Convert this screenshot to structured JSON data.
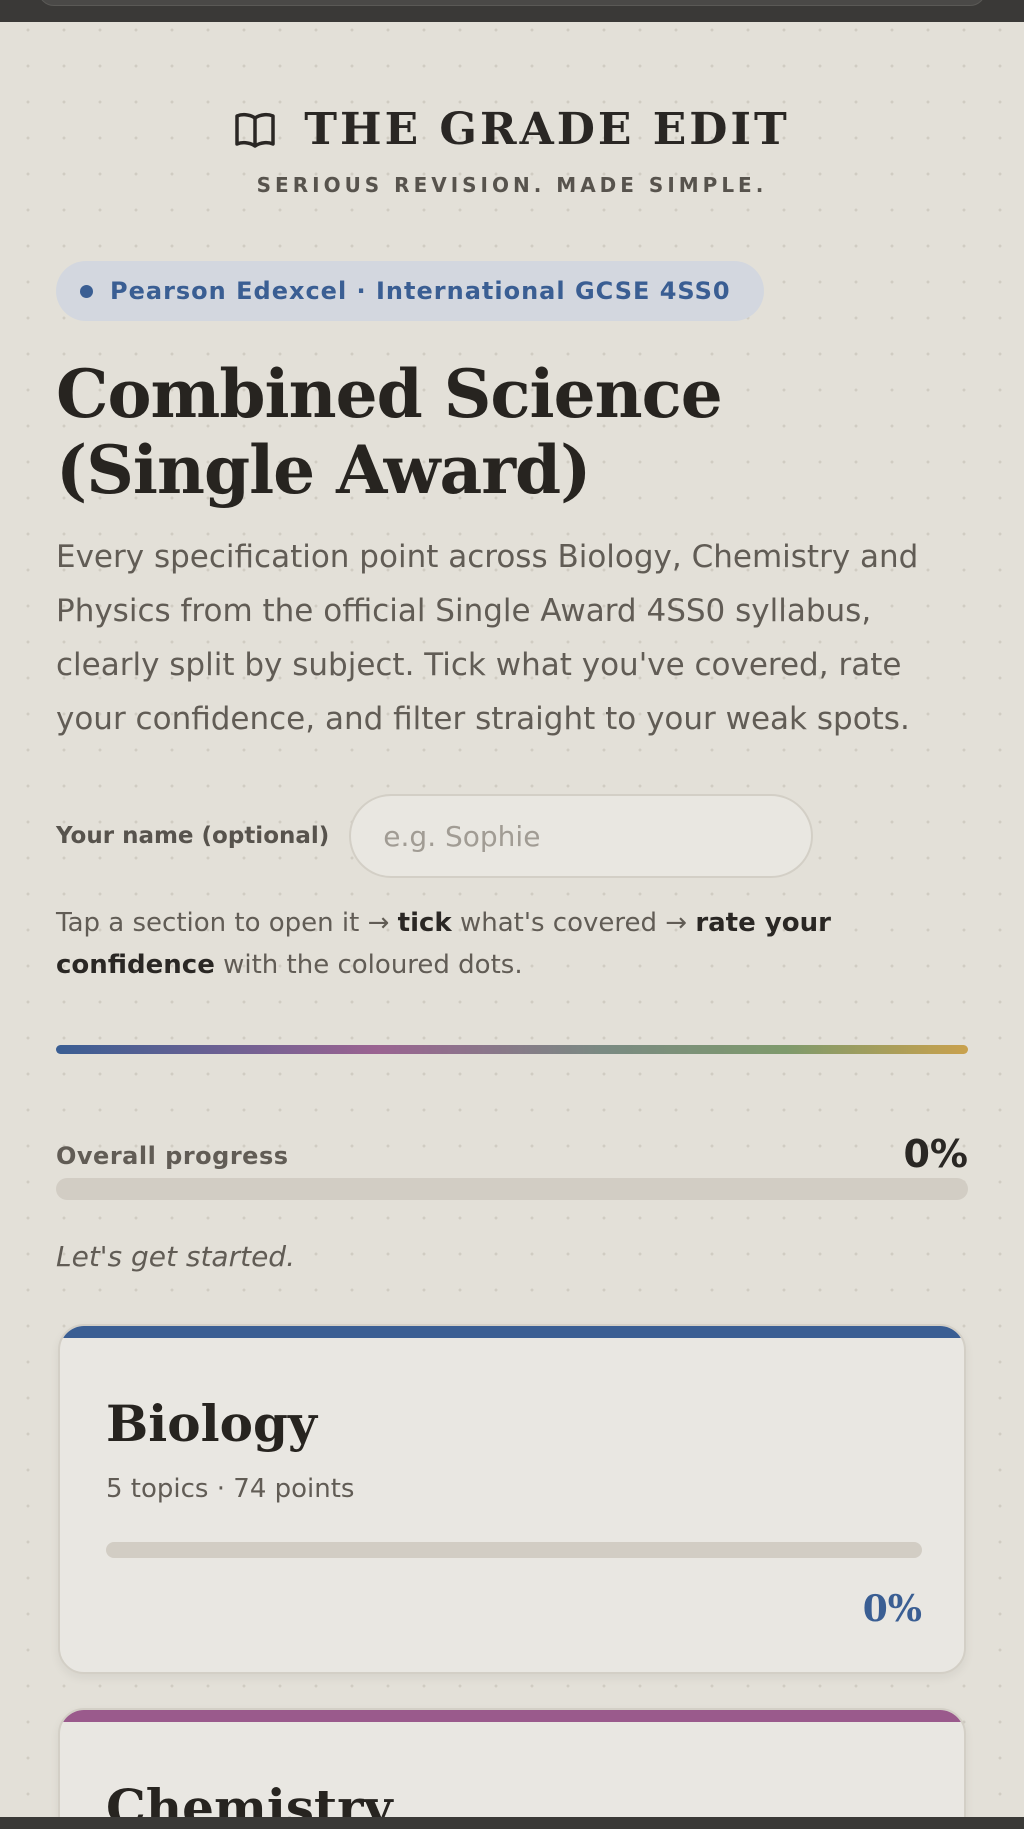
{
  "brand": {
    "title": "THE GRADE EDIT",
    "tagline": "SERIOUS REVISION. MADE SIMPLE."
  },
  "badge": {
    "text": "Pearson Edexcel · International GCSE 4SS0"
  },
  "page": {
    "title": "Combined Science (Single Award)",
    "description": "Every specification point across Biology, Chemistry and Physics from the official Single Award 4SS0 syllabus, clearly split by subject. Tick what you've covered, rate your confidence, and filter straight to your weak spots."
  },
  "name_field": {
    "label": "Your name (optional)",
    "placeholder": "e.g. Sophie",
    "value": ""
  },
  "instructions": {
    "part1": "Tap a section to open it → ",
    "bold1": "tick",
    "part2": " what's covered → ",
    "bold2": "rate your confidence",
    "part3": " with the coloured dots."
  },
  "progress": {
    "label": "Overall progress",
    "percent_text": "0%",
    "value": 0,
    "message": "Let's get started."
  },
  "subjects": [
    {
      "name": "Biology",
      "meta": "5 topics · 74 points",
      "percent_text": "0%",
      "value": 0,
      "color": "#3a5e93"
    },
    {
      "name": "Chemistry",
      "meta": "",
      "percent_text": "",
      "value": 0,
      "color": "#9a5a8c"
    }
  ],
  "colors": {
    "accent": "#3a5e93",
    "chemistry": "#9a5a8c",
    "background": "#e3e0d8"
  }
}
